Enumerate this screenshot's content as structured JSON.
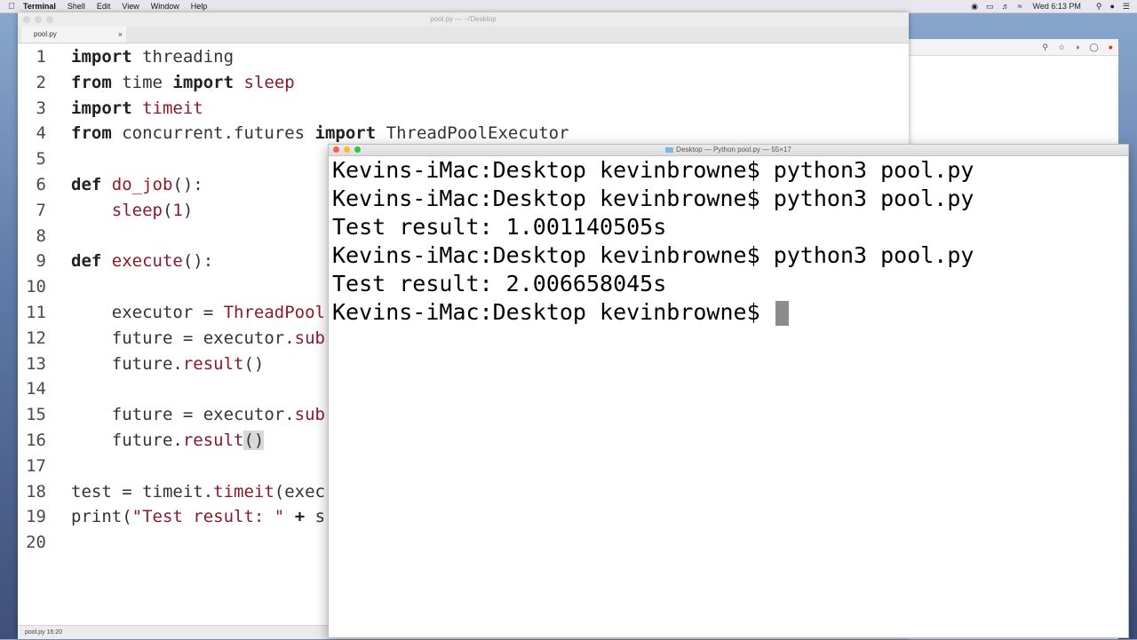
{
  "menubar": {
    "apple_icon": "apple-icon",
    "items": [
      "Terminal",
      "Shell",
      "Edit",
      "View",
      "Window",
      "Help"
    ],
    "clock": "Wed 6:13 PM"
  },
  "editor": {
    "window_title": "pool.py — ~/Desktop",
    "tab_label": "pool.py",
    "tab_close": "×",
    "status": "pool.py   16:20",
    "lines": [
      "import threading",
      "from time import sleep",
      "import timeit",
      "from concurrent.futures import ThreadPoolExecutor",
      "",
      "def do_job():",
      "    sleep(1)",
      "",
      "def execute():",
      "",
      "    executor = ThreadPool",
      "    future = executor.sub",
      "    future.result()",
      "",
      "    future = executor.sub",
      "    future.result()",
      "",
      "test = timeit.timeit(exec",
      "print(\"Test result: \" + s",
      ""
    ]
  },
  "terminal": {
    "window_title": "Desktop — Python pool.py — 55×17",
    "lines": [
      "Kevins-iMac:Desktop kevinbrowne$ python3 pool.py",
      "Kevins-iMac:Desktop kevinbrowne$ python3 pool.py",
      "Test result: 1.001140505s",
      "Kevins-iMac:Desktop kevinbrowne$ python3 pool.py",
      "Test result: 2.006658045s",
      "Kevins-iMac:Desktop kevinbrowne$ "
    ]
  },
  "colors": {
    "keyword": "#222222",
    "function": "#8b1a2b",
    "close_light": "#fc5f57",
    "minimize_light": "#fdbc2e",
    "zoom_light": "#28c840"
  }
}
